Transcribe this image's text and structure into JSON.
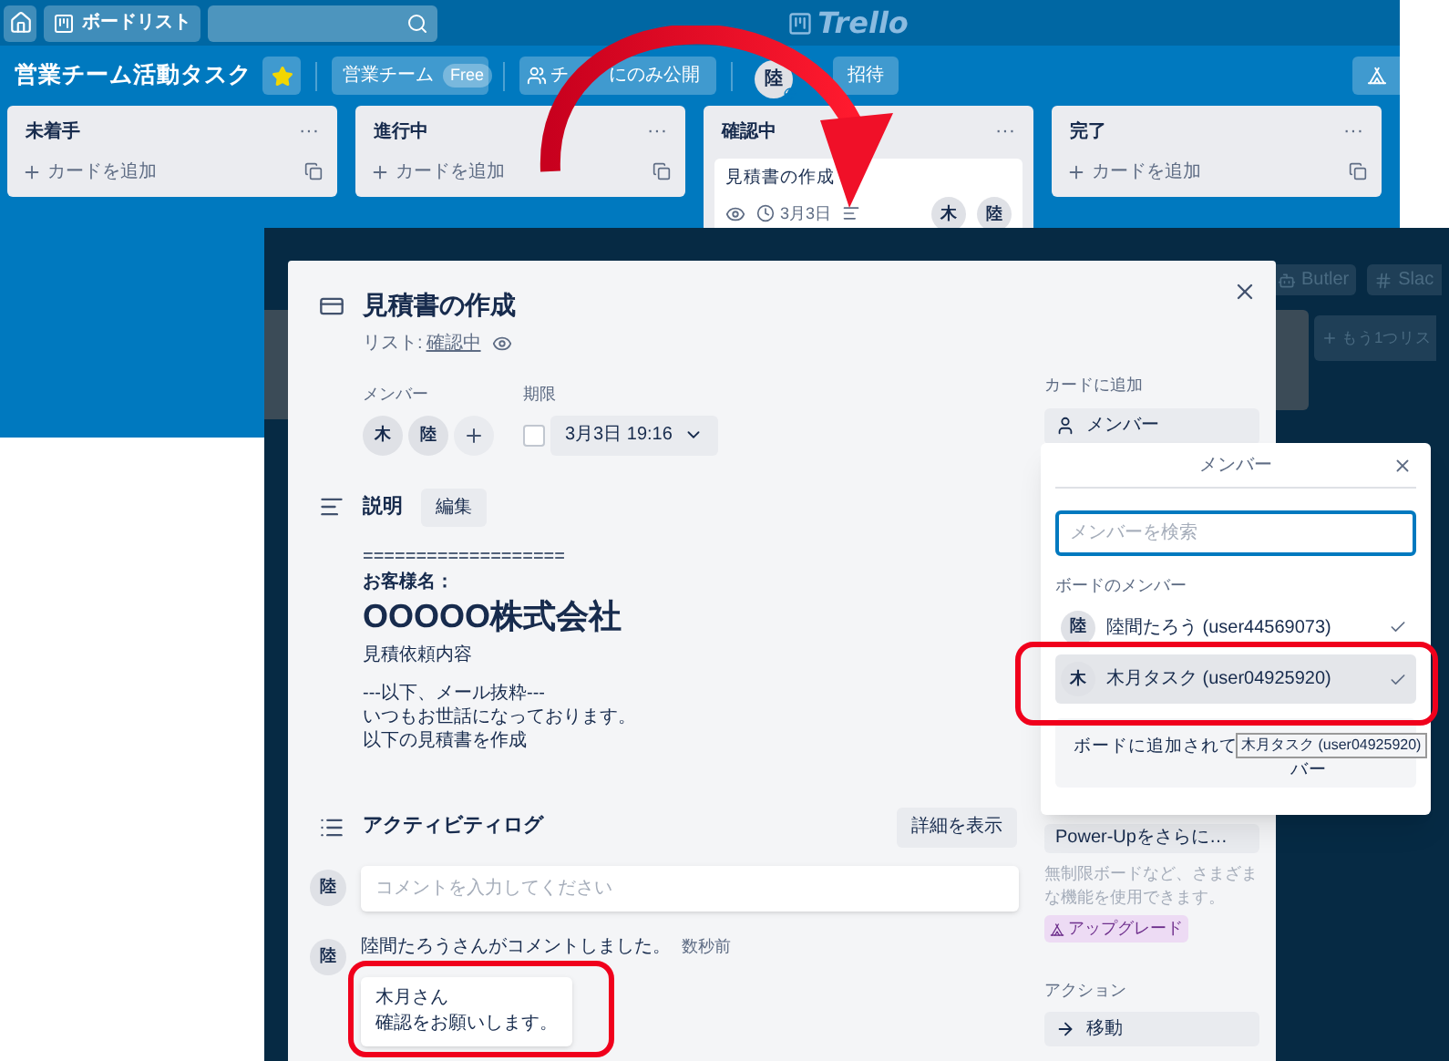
{
  "top_bar": {
    "board_list_button": "ボードリスト",
    "logo": "Trello"
  },
  "board_header": {
    "title": "営業チーム活動タスク",
    "starred": true,
    "team_button": "営業チーム",
    "team_badge": "Free",
    "visibility_start": "チ",
    "visibility_end": "にのみ公開",
    "member_avatar": "陸",
    "invite_button": "招待"
  },
  "lists": [
    {
      "title": "未着手",
      "menu": "···",
      "add_card": "カードを追加"
    },
    {
      "title": "進行中",
      "menu": "···",
      "add_card": "カードを追加"
    },
    {
      "title": "確認中",
      "menu": "···",
      "cards": [
        {
          "title": "見積書の作成",
          "due": "3月3日",
          "members": [
            "木",
            "陸"
          ]
        }
      ]
    },
    {
      "title": "完了",
      "menu": "···",
      "add_card": "カードを追加"
    }
  ],
  "background_board": {
    "butler_button": "Butler",
    "slack_button": "Slac",
    "add_list_button": "もう1つリス"
  },
  "card_modal": {
    "title": "見積書の作成",
    "list_label": "リスト:",
    "list_name": "確認中",
    "members_label": "メンバー",
    "members": [
      "木",
      "陸"
    ],
    "due_label": "期限",
    "due_complete": false,
    "due_date": "3月3日 19:16",
    "description_heading": "説明",
    "edit_button": "編集",
    "description": [
      {
        "kind": "rule",
        "text": "==================="
      },
      {
        "kind": "label",
        "text": "お客様名："
      },
      {
        "kind": "heading",
        "text": "OOOOO株式会社"
      },
      {
        "kind": "paragraph",
        "text": "見積依頼内容"
      },
      {
        "kind": "paragraph",
        "text": "---以下、メール抜粋---"
      },
      {
        "kind": "line",
        "text": "いつもお世話になっております。"
      },
      {
        "kind": "line",
        "text": "以下の見積書を作成"
      }
    ],
    "activity_heading": "アクティビティログ",
    "details_button": "詳細を表示",
    "comment_avatar": "陸",
    "comment_placeholder": "コメントを入力してください",
    "activity": [
      {
        "avatar": "陸",
        "text": "陸間たろうさんがコメントしました。",
        "time": "数秒前",
        "comment": [
          "木月さん",
          "確認をお願いします。"
        ]
      }
    ]
  },
  "sidebar": {
    "add_heading": "カードに追加",
    "member_button": "メンバー",
    "powerup_button": "Power-Upをさらに…",
    "powerup_text": "無制限ボードなど、さまざまな機能を使用できます。",
    "upgrade_badge": "アップグレード",
    "actions_heading": "アクション",
    "move_button": "移動"
  },
  "member_popup": {
    "title": "メンバー",
    "search_placeholder": "メンバーを検索",
    "section": "ボードのメンバー",
    "members": [
      {
        "avatar": "陸",
        "name": "陸間たろう (user44569073)",
        "checked": true,
        "highlighted": false
      },
      {
        "avatar": "木",
        "name": "木月タスク (user04925920)",
        "checked": true,
        "highlighted": true
      }
    ],
    "not_on_board_button": [
      "ボードに追加されて",
      "バー"
    ],
    "tooltip": "木月タスク (user04925920)"
  }
}
